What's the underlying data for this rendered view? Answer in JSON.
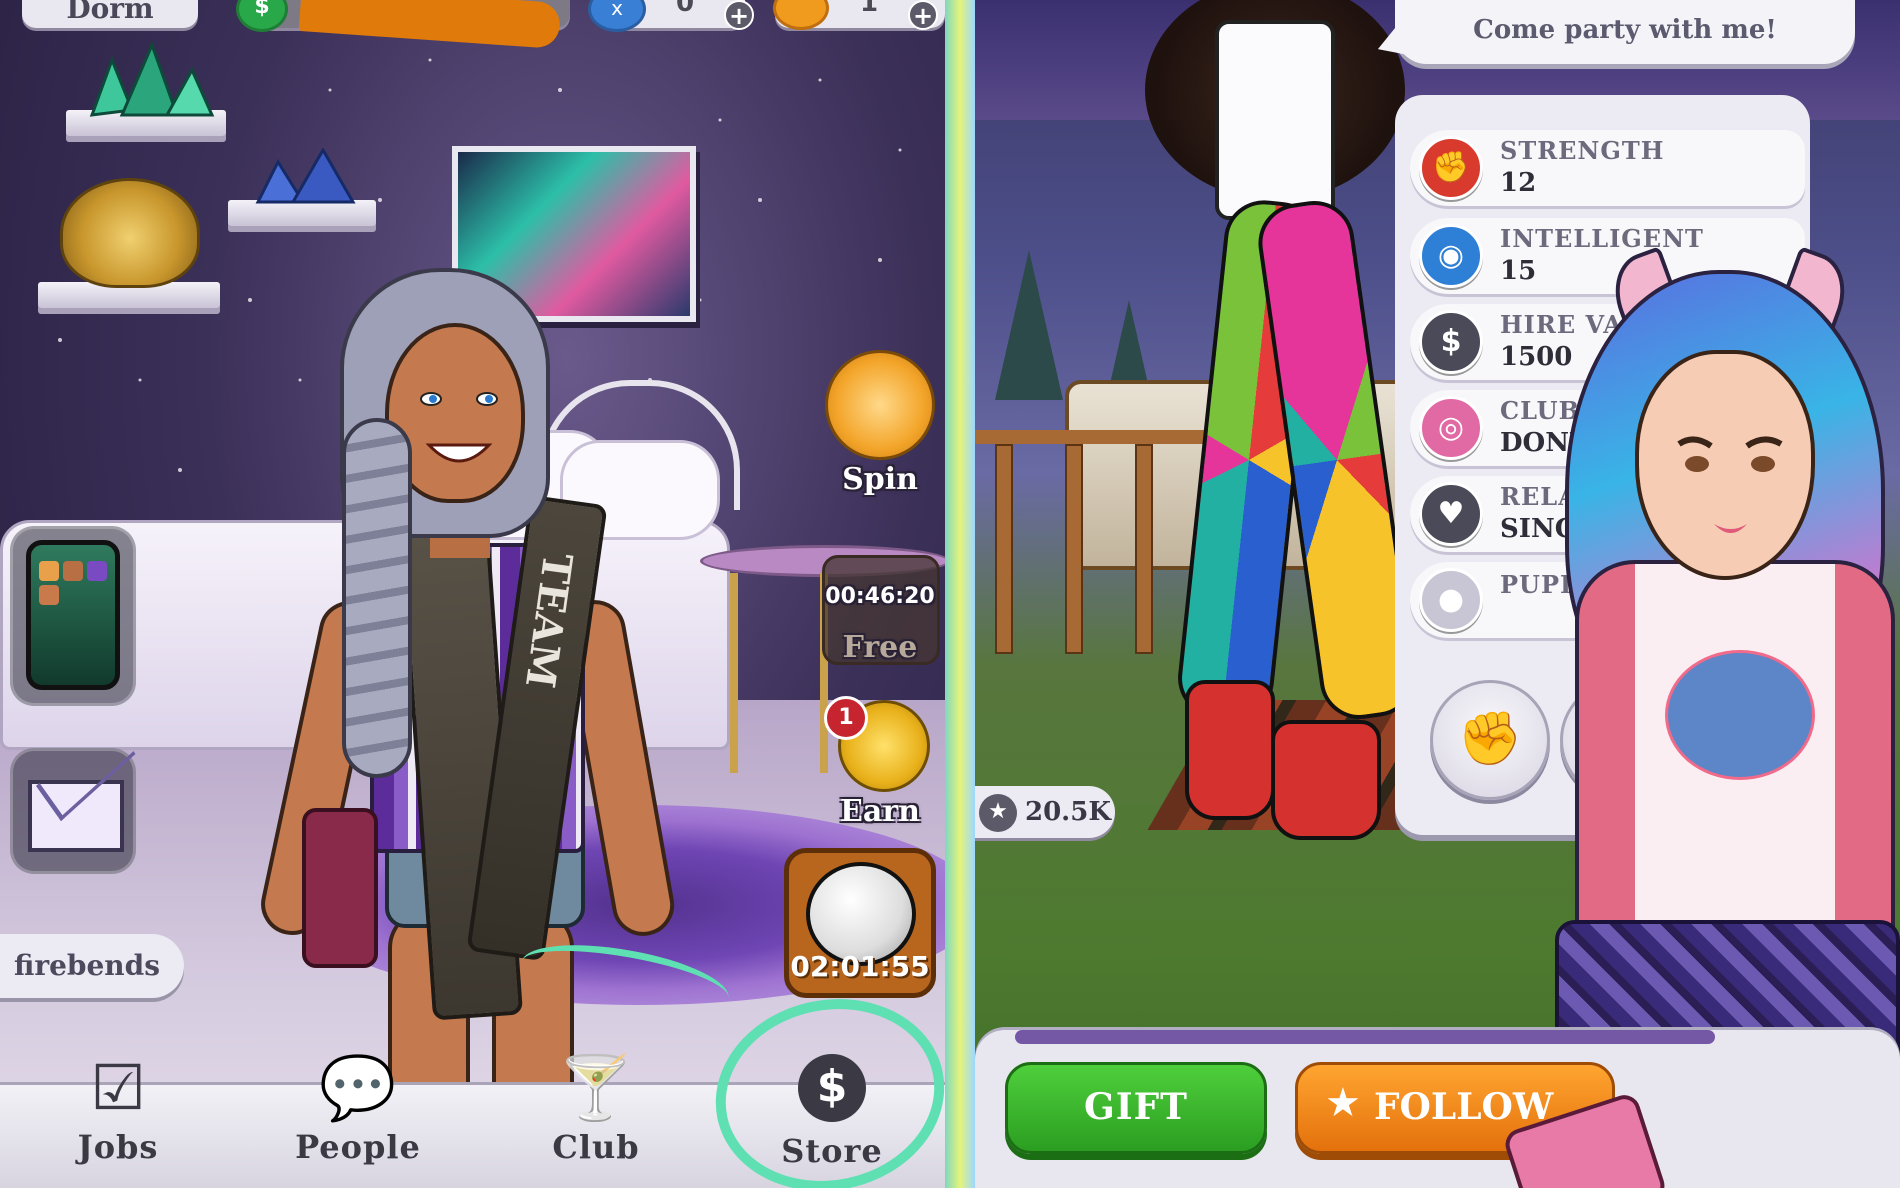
{
  "left_screen": {
    "top_bar": {
      "location_label": "Dorm",
      "money_icon": "$",
      "energy_icon": "x",
      "energy_value": "0",
      "gem_value": "1",
      "plus": "+"
    },
    "username": "firebends",
    "side_actions": {
      "spin_label": "Spin",
      "free_timer": "00:46:20",
      "free_label": "Free",
      "earn_badge": "1",
      "earn_label": "Earn",
      "event_timer": "02:01:55"
    },
    "bottom_nav": [
      {
        "label": "Jobs",
        "icon": "checkbox-icon"
      },
      {
        "label": "People",
        "icon": "chat-bubbles-icon"
      },
      {
        "label": "Club",
        "icon": "cocktail-glass-icon"
      },
      {
        "label": "Store",
        "icon": "dollar-coin-icon"
      }
    ],
    "icons": {
      "jobs": "☑",
      "people": "💬",
      "club": "🍸",
      "store": "$"
    },
    "shirt_text": "TEAM"
  },
  "right_screen": {
    "speech_bubble": "Come party with me!",
    "stats": [
      {
        "name": "STRENGTH",
        "value": "12",
        "icon": "fist-icon",
        "color": "#d83a2e"
      },
      {
        "name": "INTELLIGENT",
        "value": "15",
        "icon": "head-icon",
        "color": "#2e7fd6"
      },
      {
        "name": "HIRE VALUE",
        "value": "1500",
        "icon": "price-tag-icon",
        "color": "#4a4a58"
      },
      {
        "name": "CLUB",
        "value": "DONUTS",
        "icon": "donut-icon",
        "color": "#e26aa4"
      },
      {
        "name": "RELATIONSHIP",
        "value": "SINGLE",
        "icon": "heart-icon",
        "color": "#4a4a58"
      },
      {
        "name": "PUPIL",
        "value": "",
        "icon": "person-placeholder-icon",
        "color": "#c8c6d4"
      }
    ],
    "rating": "20.5K",
    "gift_button": "GIFT",
    "follow_button": "FOLLOW"
  },
  "colors": {
    "accent_green": "#2b9e21",
    "accent_orange": "#e4710c",
    "highlight_mint": "#5fe0b3",
    "nav_text": "#3b3a44"
  }
}
